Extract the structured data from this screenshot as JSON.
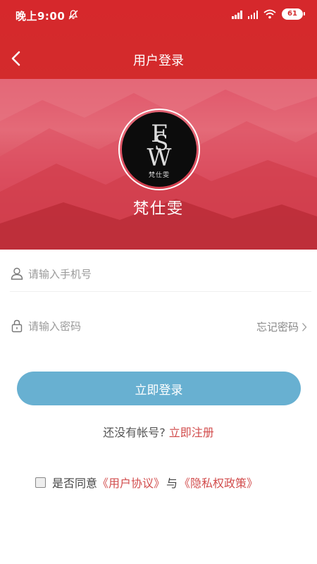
{
  "status_bar": {
    "time": "晚上9:00",
    "battery": "61",
    "mute_icon": "bell-off-icon",
    "signal_icon": "signal-bars-icon",
    "wifi_icon": "wifi-icon"
  },
  "nav": {
    "title": "用户登录",
    "back_icon": "chevron-left-icon"
  },
  "brand": {
    "logo_letters": "FSW",
    "logo_caption": "梵仕雯",
    "name": "梵仕雯"
  },
  "form": {
    "phone": {
      "placeholder": "请输入手机号",
      "value": "",
      "icon": "user-icon"
    },
    "password": {
      "placeholder": "请输入密码",
      "value": "",
      "icon": "lock-icon"
    },
    "forgot_label": "忘记密码",
    "forgot_icon": "chevron-right-icon",
    "login_label": "立即登录"
  },
  "register": {
    "prompt": "还没有帐号?",
    "link": "立即注册"
  },
  "agreement": {
    "prefix": "是否同意",
    "user_agreement": "《用户协议》",
    "joiner": "与",
    "privacy_policy": "《隐私权政策》",
    "checked": false
  },
  "colors": {
    "header_red": "#d32b2c",
    "button_blue": "#68b0d1",
    "link_red": "#d24d4d"
  }
}
